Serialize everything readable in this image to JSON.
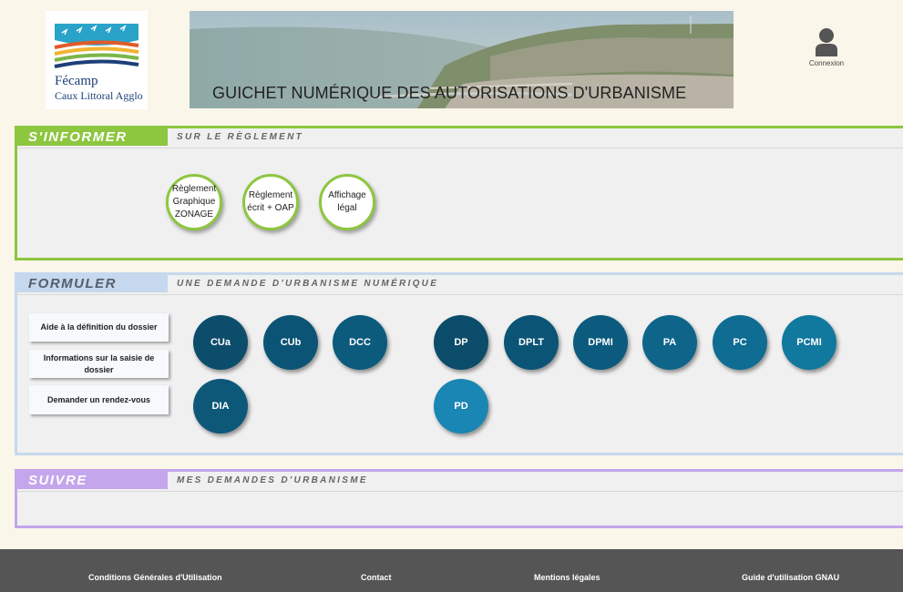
{
  "header": {
    "logo_name": "Fécamp",
    "logo_subtitle": "Caux Littoral Agglo",
    "banner_title": "GUICHET NUMÉRIQUE DES AUTORISATIONS D'URBANISME",
    "login_label": "Connexion"
  },
  "informer": {
    "tag": "S'INFORMER",
    "subtitle": "SUR LE RÈGLEMENT",
    "items": [
      {
        "line1": "Règlement",
        "line2": "Graphique",
        "line3": "ZONAGE"
      },
      {
        "line1": "Règlement",
        "line2": "écrit + OAP",
        "line3": ""
      },
      {
        "line1": "Affichage",
        "line2": "légal",
        "line3": ""
      }
    ]
  },
  "formuler": {
    "tag": "FORMULER",
    "subtitle": "UNE DEMANDE D'URBANISME NUMÉRIQUE",
    "side_buttons": [
      "Aide à la définition du dossier",
      "Informations sur la saisie de dossier",
      "Demander un rendez-vous"
    ],
    "requests": [
      {
        "label": "CUa",
        "color": "#0d4d6c"
      },
      {
        "label": "CUb",
        "color": "#0b5475"
      },
      {
        "label": "DCC",
        "color": "#0c5b7d"
      },
      {
        "label": "DP",
        "color": "#0b4c6a"
      },
      {
        "label": "DPLT",
        "color": "#0b5475"
      },
      {
        "label": "DPMI",
        "color": "#0c5b7e"
      },
      {
        "label": "PA",
        "color": "#0e6589"
      },
      {
        "label": "PC",
        "color": "#0f6c92"
      },
      {
        "label": "PCMI",
        "color": "#11789e"
      },
      {
        "label": "DIA",
        "color": "#0d5879"
      },
      {
        "label": "PD",
        "color": "#1a86b3"
      }
    ]
  },
  "suivre": {
    "tag": "SUIVRE",
    "subtitle": "MES DEMANDES D'URBANISME"
  },
  "footer": {
    "links": [
      "Conditions Générales d'Utilisation",
      "Contact",
      "Mentions légales",
      "Guide d'utilisation GNAU"
    ]
  }
}
